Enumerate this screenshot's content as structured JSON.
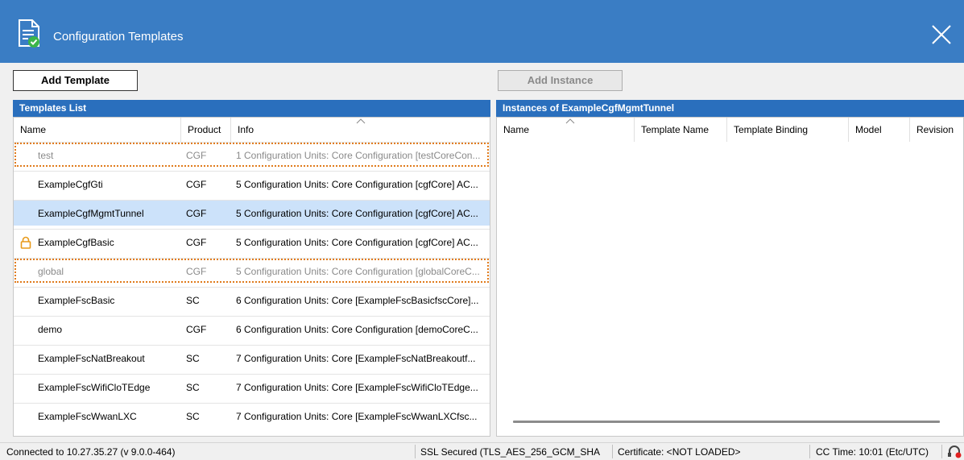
{
  "window": {
    "title": "Configuration Templates"
  },
  "toolbar": {
    "add_template": "Add Template",
    "add_instance": "Add Instance"
  },
  "templates": {
    "header": "Templates List",
    "columns": [
      "Name",
      "Product",
      "Info"
    ],
    "rows": [
      {
        "name": "test",
        "product": "CGF",
        "info": "1 Configuration Units: Core Configuration [testCoreCon...",
        "state": "dotted-grey"
      },
      {
        "name": "ExampleCgfGti",
        "product": "CGF",
        "info": "5 Configuration Units: Core Configuration [cgfCore] AC...",
        "state": "normal"
      },
      {
        "name": "ExampleCgfMgmtTunnel",
        "product": "CGF",
        "info": "5 Configuration Units: Core Configuration [cgfCore] AC...",
        "state": "selected"
      },
      {
        "name": "ExampleCgfBasic",
        "product": "CGF",
        "info": "5 Configuration Units: Core Configuration [cgfCore] AC...",
        "state": "locked"
      },
      {
        "name": "global",
        "product": "CGF",
        "info": "5 Configuration Units: Core Configuration [globalCoreC...",
        "state": "dotted-grey"
      },
      {
        "name": "ExampleFscBasic",
        "product": "SC",
        "info": "6 Configuration Units: Core [ExampleFscBasicfscCore]...",
        "state": "normal"
      },
      {
        "name": "demo",
        "product": "CGF",
        "info": "6 Configuration Units: Core Configuration [demoCoreC...",
        "state": "normal"
      },
      {
        "name": "ExampleFscNatBreakout",
        "product": "SC",
        "info": "7 Configuration Units: Core [ExampleFscNatBreakoutf...",
        "state": "normal"
      },
      {
        "name": "ExampleFscWifiCloTEdge",
        "product": "SC",
        "info": "7 Configuration Units: Core [ExampleFscWifiCloTEdge...",
        "state": "normal"
      },
      {
        "name": "ExampleFscWwanLXC",
        "product": "SC",
        "info": "7 Configuration Units: Core [ExampleFscWwanLXCfsc...",
        "state": "normal"
      }
    ]
  },
  "instances": {
    "header": "Instances of ExampleCgfMgmtTunnel",
    "columns": [
      "Name",
      "Template Name",
      "Template Binding",
      "Model",
      "Revision"
    ]
  },
  "status": {
    "connection": "Connected to 10.27.35.27 (v 9.0.0-464)",
    "ssl": "SSL Secured (TLS_AES_256_GCM_SHA",
    "certificate": "Certificate: <NOT LOADED>",
    "cc_time": "CC Time: 10:01 (Etc/UTC)"
  },
  "icons": {
    "app": "document-check-icon",
    "close": "close-icon",
    "lock": "lock-icon",
    "sort": "sort-ascending-icon",
    "status": "headset-alert-icon"
  },
  "colors": {
    "titlebar": "#3a7dc4",
    "panel_header": "#2a6fbd",
    "selection": "#cce2fa",
    "dotted_outline": "#e07b1c",
    "lock": "#e89a1a"
  }
}
